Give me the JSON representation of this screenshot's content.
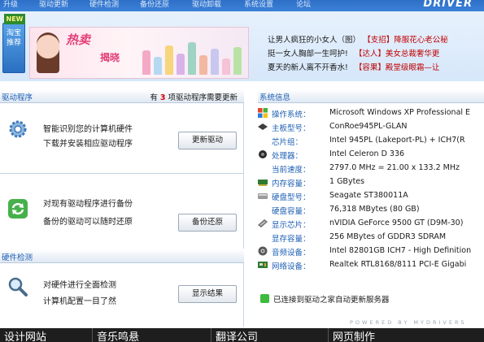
{
  "nav": {
    "items": [
      "升级",
      "驱动更新",
      "硬件检测",
      "备份还原",
      "驱动卸载",
      "系统设置",
      "论坛"
    ],
    "brand": "DRIVER"
  },
  "banner": {
    "new_tag": "NEW",
    "side_tab": "淘宝推荐",
    "ad_title": "热卖",
    "ad_subtitle": "揭晓",
    "links": [
      {
        "text": "让男人疯狂的小女人（图）",
        "tag": "【支招】降服花心老公秘"
      },
      {
        "text": "挺一女人胸部一生呵护!",
        "tag": "【达人】美女总裁奢华更"
      },
      {
        "text": "夏天的新人离不开香水!",
        "tag": "【容果】殿堂级眼霜—让"
      }
    ]
  },
  "driver_section": {
    "title": "驱动程序",
    "update_prefix": "有",
    "update_count": "3",
    "update_suffix": "项驱动程序需要更新",
    "rows": [
      {
        "line1": "智能识别您的计算机硬件",
        "line2": "下载并安装相应驱动程序",
        "button": "更新驱动"
      },
      {
        "line1": "对现有驱动程序进行备份",
        "line2": "备份的驱动可以随时还原",
        "button": "备份还原"
      }
    ]
  },
  "hardware_section": {
    "title": "硬件检测",
    "line1": "对硬件进行全面检测",
    "line2": "计算机配置一目了然",
    "button": "显示结果"
  },
  "system_info": {
    "title": "系统信息",
    "rows": [
      {
        "icon": "windows-logo-icon",
        "label": "操作系统：",
        "value": "Microsoft Windows XP Professional E"
      },
      {
        "icon": "motherboard-icon",
        "label": "主板型号：",
        "value": "ConRoe945PL-GLAN"
      },
      {
        "icon": "",
        "label": "芯片组：",
        "value": "Intel 945PL (Lakeport-PL) + ICH7(R"
      },
      {
        "icon": "cpu-icon",
        "label": "处理器：",
        "value": "Intel Celeron D 336"
      },
      {
        "icon": "",
        "label": "当前速度：",
        "value": "2797.0 MHz = 21.00 x 133.2 MHz"
      },
      {
        "icon": "memory-icon",
        "label": "内存容量：",
        "value": "1 GBytes"
      },
      {
        "icon": "hard-disk-icon",
        "label": "硬盘型号：",
        "value": "Seagate ST380011A"
      },
      {
        "icon": "",
        "label": "硬盘容量：",
        "value": "76,318 MBytes (80 GB)"
      },
      {
        "icon": "graphics-card-icon",
        "label": "显示芯片：",
        "value": "nVIDIA GeForce 9500 GT (D9M-30)"
      },
      {
        "icon": "",
        "label": "显存容量：",
        "value": "256 MBytes of GDDR3 SDRAM"
      },
      {
        "icon": "audio-device-icon",
        "label": "音频设备：",
        "value": "Intel 82801GB ICH7 - High Definition"
      },
      {
        "icon": "network-card-icon",
        "label": "网络设备：",
        "value": "Realtek RTL8168/8111 PCI-E Gigabi"
      }
    ],
    "connection": "已连接到驱动之家自动更新服务器",
    "powered": "POWERED BY MYDRIVERS"
  },
  "bottom_bar": [
    "设计网站",
    "音乐鸣悬",
    "翻译公司",
    "网页制作"
  ],
  "colors": {
    "accent": "#1d5fb3",
    "count_red": "#d40000",
    "nav_blue": "#3b82d8",
    "bottom_bar": "#1e1e1e"
  }
}
